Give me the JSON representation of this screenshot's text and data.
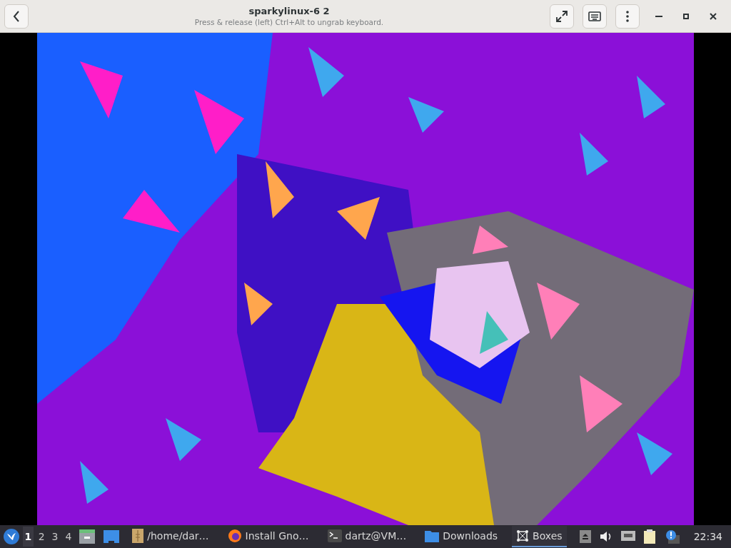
{
  "window": {
    "title": "sparkylinux-6 2",
    "subtitle": "Press & release (left) Ctrl+Alt to ungrab keyboard."
  },
  "taskbar": {
    "workspaces": [
      {
        "label": "1",
        "selected": true
      },
      {
        "label": "2",
        "selected": false
      },
      {
        "label": "3",
        "selected": false
      },
      {
        "label": "4",
        "selected": false
      }
    ],
    "tasks": [
      {
        "kind": "files",
        "label": "/home/dar…",
        "selected": false
      },
      {
        "kind": "browser",
        "label": "Install Gno…",
        "selected": false
      },
      {
        "kind": "terminal",
        "label": "dartz@VM…",
        "selected": false
      },
      {
        "kind": "folder",
        "label": "Downloads",
        "selected": false
      },
      {
        "kind": "boxes",
        "label": "Boxes",
        "selected": true
      }
    ],
    "clock": "22:34"
  }
}
